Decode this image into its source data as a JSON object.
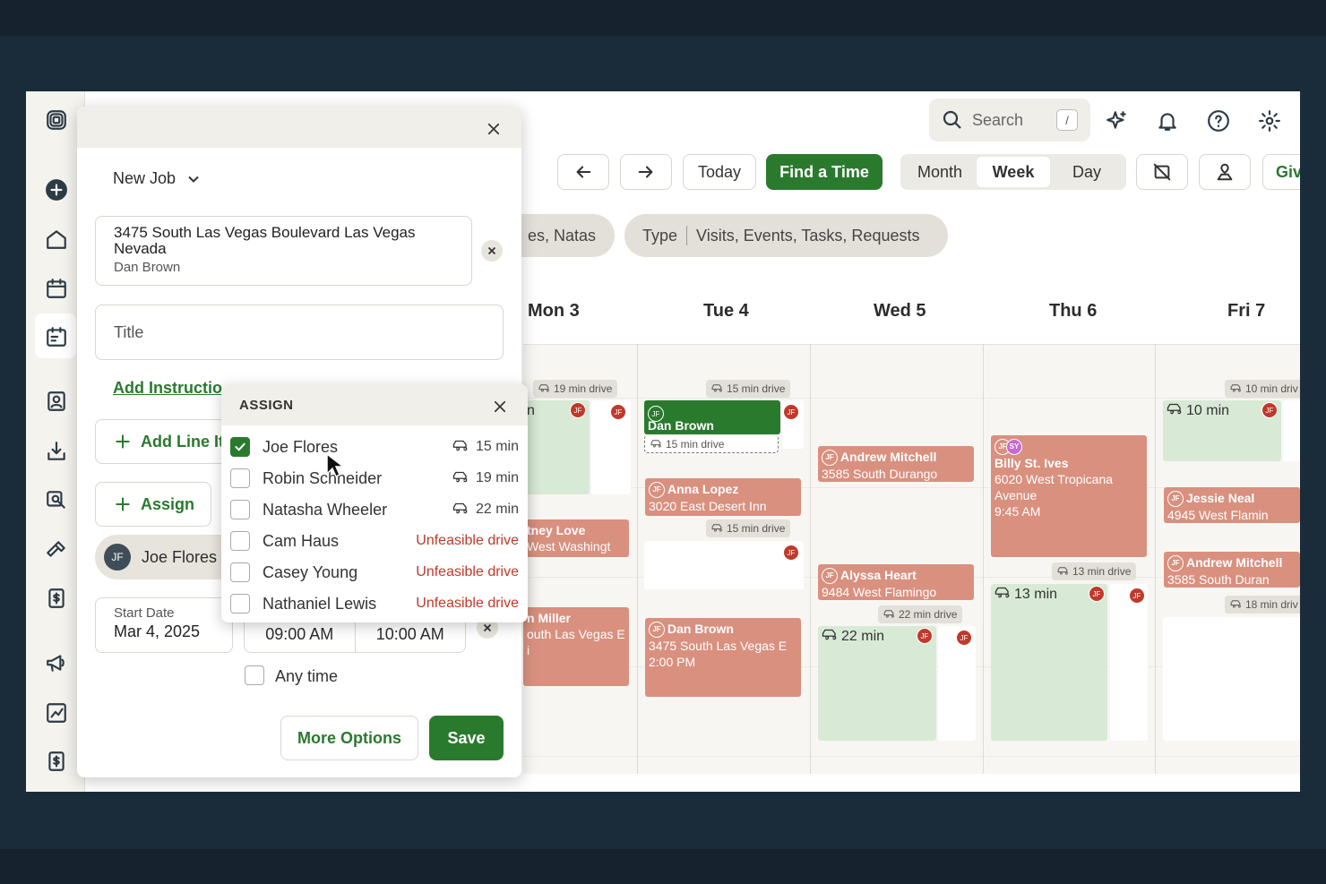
{
  "top": {
    "search_label": "Search",
    "search_kbd": "/"
  },
  "toolbar": {
    "today": "Today",
    "find_time": "Find a Time",
    "views": [
      "Month",
      "Week",
      "Day"
    ],
    "selected_view": "Week",
    "give_partial": "Giv"
  },
  "filters": {
    "people_partial": "es, Natas",
    "type_label": "Type",
    "type_value": "Visits, Events, Tasks, Requests"
  },
  "days": [
    "Mon 3",
    "Tue 4",
    "Wed 5",
    "Thu 6",
    "Fri 7"
  ],
  "drives": {
    "mon": "19 min drive",
    "tue1": "15 min drive",
    "tue2": "15 min drive",
    "wed": "22 min drive",
    "thu": "13 min drive",
    "fri1": "10 min driv",
    "fri2": "18 min driv",
    "tue_dashed": "15 min drive"
  },
  "events": {
    "mon_n": "n",
    "mon_love_name": "tney Love",
    "mon_love_addr": "West Washingt",
    "mon_miller_name": "n Miller",
    "mon_miller_addr": "outh Las Vegas E",
    "mon_miller_extra": "i",
    "tue_dan_name": "Dan Brown",
    "tue_anna_name": "Anna Lopez",
    "tue_anna_addr": "3020 East Desert Inn",
    "tue_dan2_name": "Dan Brown",
    "tue_dan2_addr": "3475 South Las Vegas E",
    "tue_dan2_time": "2:00 PM",
    "wed_andrew_name": "Andrew Mitchell",
    "wed_andrew_addr": "3585 South Durango",
    "wed_alyssa_name": "Alyssa Heart",
    "wed_alyssa_addr": "9484 West Flamingo",
    "wed_time": "22 min",
    "thu_billy_name": "Billy St. Ives",
    "thu_billy_addr1": "6020 West Tropicana",
    "thu_billy_addr2": "Avenue",
    "thu_billy_time": "9:45 AM",
    "thu_time": "13 min",
    "fri_time": "10 min",
    "fri_jessie_name": "Jessie Neal",
    "fri_jessie_addr": "4945 West Flamin",
    "fri_andrew_name": "Andrew Mitchell",
    "fri_andrew_addr": "3585 South Duran",
    "initials_jf": "JF",
    "initials_sy": "SY"
  },
  "panel": {
    "job_type": "New Job",
    "address_line1": "3475 South Las Vegas Boulevard Las Vegas",
    "address_line2": "Nevada",
    "client": "Dan Brown",
    "title_placeholder": "Title",
    "add_instructions": "Add Instructio",
    "add_line_item": "Add Line It",
    "assign": "Assign",
    "assignee": "Joe Flores",
    "assignee_initials": "JF",
    "start_date_label": "Start Date",
    "start_date": "Mar 4, 2025",
    "start_time": "09:00 AM",
    "end_time": "10:00 AM",
    "any_time": "Any time",
    "more_options": "More Options",
    "save": "Save"
  },
  "assign_popup": {
    "title": "ASSIGN",
    "people": [
      {
        "name": "Joe Flores",
        "info": "15 min",
        "checked": true,
        "feasible": true
      },
      {
        "name": "Robin Schneider",
        "info": "19 min",
        "checked": false,
        "feasible": true
      },
      {
        "name": "Natasha Wheeler",
        "info": "22 min",
        "checked": false,
        "feasible": true
      },
      {
        "name": "Cam Haus",
        "info": "Unfeasible drive",
        "checked": false,
        "feasible": false
      },
      {
        "name": "Casey Young",
        "info": "Unfeasible drive",
        "checked": false,
        "feasible": false
      },
      {
        "name": "Nathaniel Lewis",
        "info": "Unfeasible drive",
        "checked": false,
        "feasible": false
      }
    ]
  },
  "colors": {
    "accent_green": "#2a7a2e",
    "event_salmon": "#d9907f",
    "event_green": "#d8ead6",
    "unfeasible_red": "#c0392b"
  }
}
